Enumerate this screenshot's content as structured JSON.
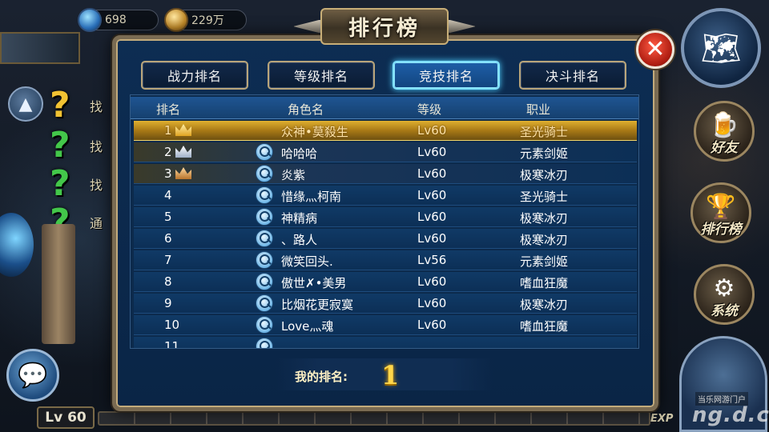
{
  "hud": {
    "gems": "698",
    "gold": "229万",
    "player_level": "Lv 60",
    "exp_label": "EXP",
    "quests": [
      {
        "mark": "?",
        "color": "gold",
        "label": "找"
      },
      {
        "mark": "?",
        "color": "green",
        "label": "找"
      },
      {
        "mark": "?",
        "color": "green",
        "label": "找"
      },
      {
        "mark": "?",
        "color": "green",
        "label": "通"
      }
    ],
    "side_buttons": {
      "friends": "好友",
      "ranking": "排行榜",
      "system": "系统"
    }
  },
  "modal": {
    "title": "排行榜",
    "close_icon": "close-icon",
    "tabs": [
      {
        "label": "战力排名",
        "active": false
      },
      {
        "label": "等级排名",
        "active": false
      },
      {
        "label": "竞技排名",
        "active": true
      },
      {
        "label": "决斗排名",
        "active": false
      }
    ],
    "columns": {
      "rank": "排名",
      "name": "角色名",
      "level": "等级",
      "job": "职业"
    },
    "rows": [
      {
        "rank": "1",
        "crown": "gold",
        "name": "众神•莫殺生",
        "level": "Lv60",
        "job": "圣光骑士",
        "search": false
      },
      {
        "rank": "2",
        "crown": "silver",
        "name": "哈哈哈",
        "level": "Lv60",
        "job": "元素剑姬",
        "search": true
      },
      {
        "rank": "3",
        "crown": "bronze",
        "name": "炎紫",
        "level": "Lv60",
        "job": "极寒冰刃",
        "search": true
      },
      {
        "rank": "4",
        "crown": "",
        "name": "惜缘灬柯南",
        "level": "Lv60",
        "job": "圣光骑士",
        "search": true
      },
      {
        "rank": "5",
        "crown": "",
        "name": "神精病",
        "level": "Lv60",
        "job": "极寒冰刃",
        "search": true
      },
      {
        "rank": "6",
        "crown": "",
        "name": "、路人",
        "level": "Lv60",
        "job": "极寒冰刃",
        "search": true
      },
      {
        "rank": "7",
        "crown": "",
        "name": "微笑回头.",
        "level": "Lv56",
        "job": "元素剑姬",
        "search": true
      },
      {
        "rank": "8",
        "crown": "",
        "name": "傲世✗•美男",
        "level": "Lv60",
        "job": "嗜血狂魔",
        "search": true
      },
      {
        "rank": "9",
        "crown": "",
        "name": "比烟花更寂寞",
        "level": "Lv60",
        "job": "极寒冰刃",
        "search": true
      },
      {
        "rank": "10",
        "crown": "",
        "name": "Love灬魂",
        "level": "Lv60",
        "job": "嗜血狂魔",
        "search": true
      },
      {
        "rank": "11",
        "crown": "",
        "name": "",
        "level": "",
        "job": "",
        "search": true
      }
    ],
    "my_rank_label": "我的排名:",
    "my_rank_value": "1"
  },
  "watermark": {
    "small": "当乐网游门户",
    "big": "ng.d.cn"
  }
}
